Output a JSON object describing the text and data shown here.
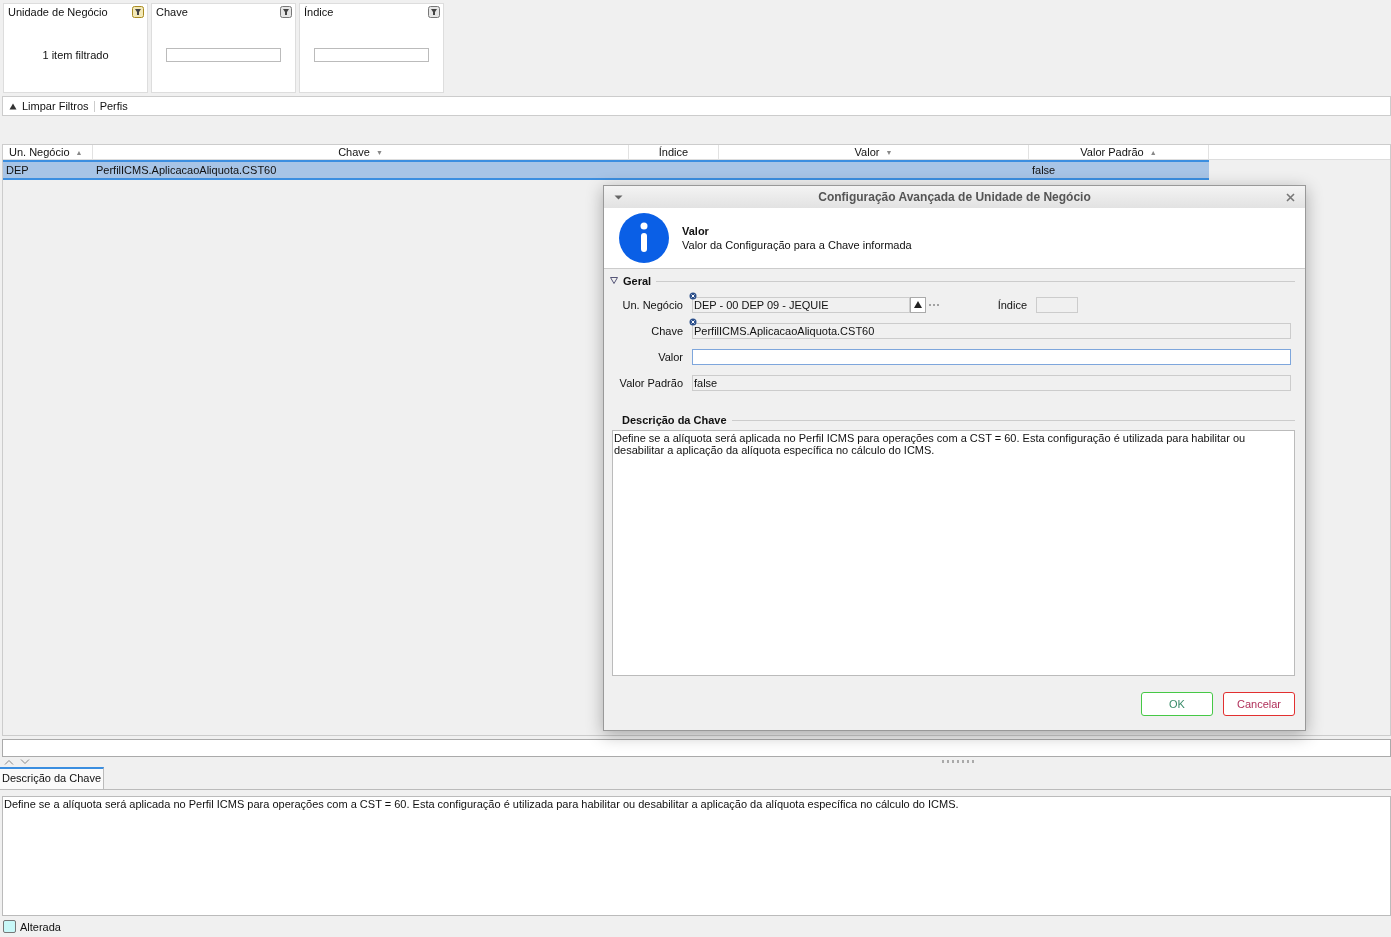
{
  "filters": [
    {
      "title": "Unidade de Negócio",
      "active": true,
      "summary": "1 item filtrado"
    },
    {
      "title": "Chave",
      "active": false
    },
    {
      "title": "Índice",
      "active": false
    }
  ],
  "filter_toolbar": {
    "items": [
      "Limpar Filtros",
      "Perfis"
    ]
  },
  "table": {
    "columns": [
      {
        "label": "Un. Negócio",
        "sort_mark": "▲"
      },
      {
        "label": "Chave",
        "sort_mark": "▼"
      },
      {
        "label": "Índice"
      },
      {
        "label": "Valor",
        "sort_mark": "▼"
      },
      {
        "label": "Valor Padrão",
        "sort_mark": "▲"
      }
    ],
    "rows": [
      {
        "selected": true,
        "cells": [
          "DEP",
          "PerfilICMS.AplicacaoAliquota.CST60",
          "",
          "",
          "false"
        ]
      }
    ]
  },
  "dialog": {
    "title": "Configuração Avançada de Unidade de Negócio",
    "header_title": "Valor",
    "header_subtitle": "Valor da Configuração para a Chave informada",
    "section": "Geral",
    "expanded": true,
    "fields": [
      {
        "label": "Un. Negócio",
        "value": "DEP - 00 DEP 09 - JEQUIE",
        "kind": "lookup",
        "required": true
      },
      {
        "label": "Chave",
        "value": "PerfilICMS.AplicacaoAliquota.CST60",
        "kind": "text",
        "required": true
      },
      {
        "label": "Valor",
        "kind": "edit",
        "required": false
      },
      {
        "label": "Valor Padrão",
        "value": "false",
        "kind": "text",
        "required": false
      }
    ],
    "index_label": "Índice",
    "description_title": "Descrição da Chave",
    "description": "Define se a alíquota será aplicada no Perfil ICMS para operações com a CST = 60. Esta configuração é utilizada para habilitar ou desabilitar a aplicação da alíquota específica no cálculo do ICMS.",
    "buttons": [
      {
        "label": "OK",
        "kind": "ok"
      },
      {
        "label": "Cancelar",
        "kind": "cancel"
      }
    ]
  },
  "detail_tabs": [
    {
      "label": "Descrição da Chave",
      "selected": true
    }
  ],
  "detail_text": "Define se a alíquota será aplicada no Perfil ICMS para operações com a CST = 60. Esta configuração é utilizada para habilitar ou desabilitar a aplicação da alíquota específica no cálculo do ICMS.",
  "legend": [
    {
      "label": "Alterada",
      "color": "#c8f8f8"
    }
  ]
}
